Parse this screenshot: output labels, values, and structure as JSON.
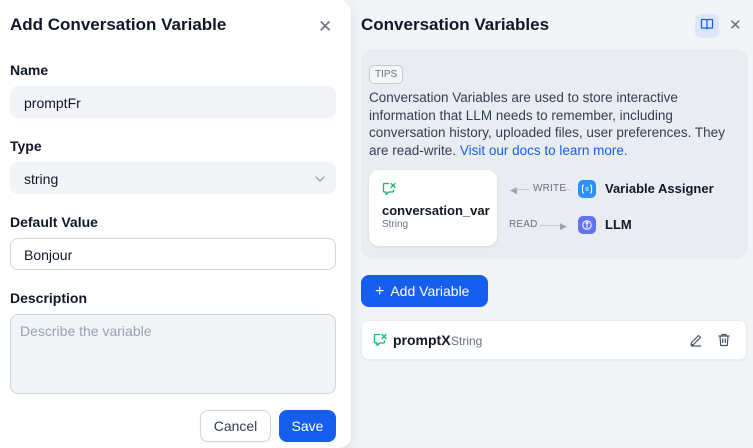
{
  "left_panel": {
    "title": "Add Conversation Variable",
    "name_label": "Name",
    "name_value": "promptFr",
    "type_label": "Type",
    "type_value": "string",
    "default_label": "Default Value",
    "default_value": "Bonjour",
    "description_label": "Description",
    "description_placeholder": "Describe the variable",
    "cancel_label": "Cancel",
    "save_label": "Save"
  },
  "right_panel": {
    "title": "Conversation Variables",
    "tips_badge": "TIPS",
    "tips_text": "Conversation Variables are used to store interactive information that LLM needs to remember, including conversation history, uploaded files, user preferences. They are read-write.",
    "tips_link": "Visit our docs to learn more.",
    "card_var_name": "conversation_var",
    "card_var_type": "String",
    "write_label": "WRITE",
    "read_label": "READ",
    "assigner_label": "Variable Assigner",
    "llm_label": "LLM",
    "add_variable_label": "Add Variable",
    "variables": [
      {
        "name": "promptX",
        "type": "String"
      }
    ]
  },
  "icons": {
    "close": "close-icon",
    "book": "book-icon",
    "chevron": "chevron-down-icon",
    "variable": "conversation-variable-icon",
    "assigner": "variable-assigner-icon",
    "llm": "llm-icon",
    "edit": "pencil-icon",
    "delete": "trash-icon"
  },
  "colors": {
    "primary": "#155eef",
    "variable_icon": "#12b76a",
    "assigner_icon": "#2e90fa",
    "llm_icon": "#6172f3"
  }
}
